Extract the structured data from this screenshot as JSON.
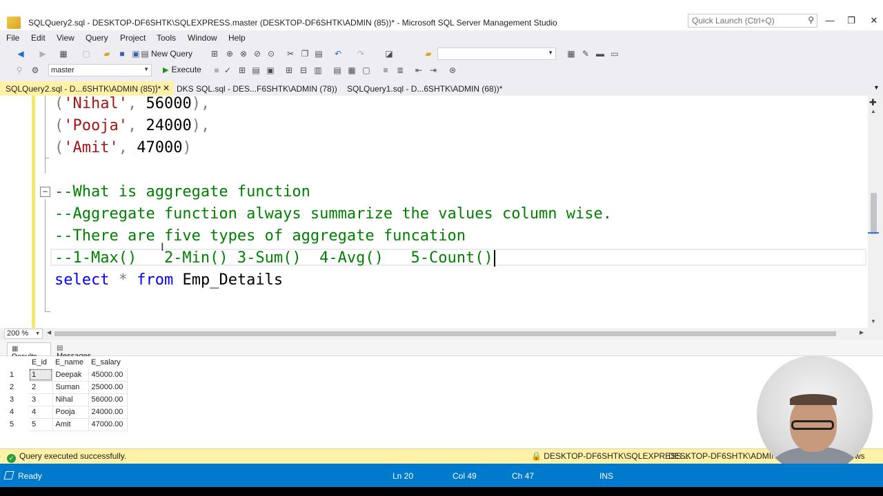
{
  "window": {
    "title": "SQLQuery2.sql - DESKTOP-DF6SHTK\\SQLEXPRESS.master (DESKTOP-DF6SHTK\\ADMIN (85))* - Microsoft SQL Server Management Studio",
    "quick_launch_placeholder": "Quick Launch (Ctrl+Q)",
    "minimize": "—",
    "restore": "❐",
    "close": "✕"
  },
  "menu": [
    "File",
    "Edit",
    "View",
    "Query",
    "Project",
    "Tools",
    "Window",
    "Help"
  ],
  "toolbar": {
    "new_query_label": "New Query",
    "database": "master",
    "execute_label": "Execute"
  },
  "tabs": [
    {
      "label": "SQLQuery2.sql - D...6SHTK\\ADMIN (85))*",
      "active": true
    },
    {
      "label": "DKS SQL.sql - DES...F6SHTK\\ADMIN (78))",
      "active": false
    },
    {
      "label": "SQLQuery1.sql - D...6SHTK\\ADMIN (68))*",
      "active": false
    }
  ],
  "editor": {
    "lines": [
      {
        "tokens": [
          {
            "t": "(",
            "c": "gray"
          },
          {
            "t": "'Nihal'",
            "c": "red"
          },
          {
            "t": ", ",
            "c": "gray"
          },
          {
            "t": "56000",
            "c": "black"
          },
          {
            "t": "),",
            "c": "gray"
          }
        ]
      },
      {
        "tokens": [
          {
            "t": "(",
            "c": "gray"
          },
          {
            "t": "'Pooja'",
            "c": "red"
          },
          {
            "t": ", ",
            "c": "gray"
          },
          {
            "t": "24000",
            "c": "black"
          },
          {
            "t": "),",
            "c": "gray"
          }
        ]
      },
      {
        "tokens": [
          {
            "t": "(",
            "c": "gray"
          },
          {
            "t": "'Amit'",
            "c": "red"
          },
          {
            "t": ", ",
            "c": "gray"
          },
          {
            "t": "47000",
            "c": "black"
          },
          {
            "t": ")",
            "c": "gray"
          }
        ]
      },
      {
        "tokens": []
      },
      {
        "tokens": [
          {
            "t": "--What is aggregate function",
            "c": "green"
          }
        ]
      },
      {
        "tokens": [
          {
            "t": "--Aggregate function always summarize the values column wise.",
            "c": "green"
          }
        ]
      },
      {
        "tokens": [
          {
            "t": "--There are five types of aggregate funcation",
            "c": "green"
          }
        ]
      },
      {
        "tokens": [
          {
            "t": "--1-Max()   2-Min() 3-Sum()  4-Avg()   5-Count()",
            "c": "green"
          }
        ]
      },
      {
        "tokens": [
          {
            "t": "select",
            "c": "blue"
          },
          {
            "t": " * ",
            "c": "gray"
          },
          {
            "t": "from",
            "c": "blue"
          },
          {
            "t": " Emp_Details",
            "c": "black"
          }
        ]
      }
    ],
    "zoom": "200 %"
  },
  "results": {
    "tabs": [
      "Results",
      "Messages"
    ],
    "columns": [
      "E_id",
      "E_name",
      "E_salary"
    ],
    "rows": [
      {
        "num": "1",
        "id": "1",
        "name": "Deepak",
        "salary": "45000.00"
      },
      {
        "num": "2",
        "id": "2",
        "name": "Suman",
        "salary": "25000.00"
      },
      {
        "num": "3",
        "id": "3",
        "name": "Nihal",
        "salary": "56000.00"
      },
      {
        "num": "4",
        "id": "4",
        "name": "Pooja",
        "salary": "24000.00"
      },
      {
        "num": "5",
        "id": "5",
        "name": "Amit",
        "salary": "47000.00"
      }
    ]
  },
  "query_status": {
    "message": "Query executed successfully.",
    "server": "DESKTOP-DF6SHTK\\SQLEXPRESS ...",
    "user": "DESKTOP-DF6SHTK\\ADMIN ...",
    "rows": "ws"
  },
  "statusbar": {
    "ready": "Ready",
    "ln": "Ln 20",
    "col": "Col 49",
    "ch": "Ch 47",
    "mode": "INS"
  },
  "colors": {
    "accent": "#007acc",
    "active_tab": "#fff1a8",
    "comment": "#008000",
    "keyword": "#0000ff",
    "string": "#a31515"
  }
}
